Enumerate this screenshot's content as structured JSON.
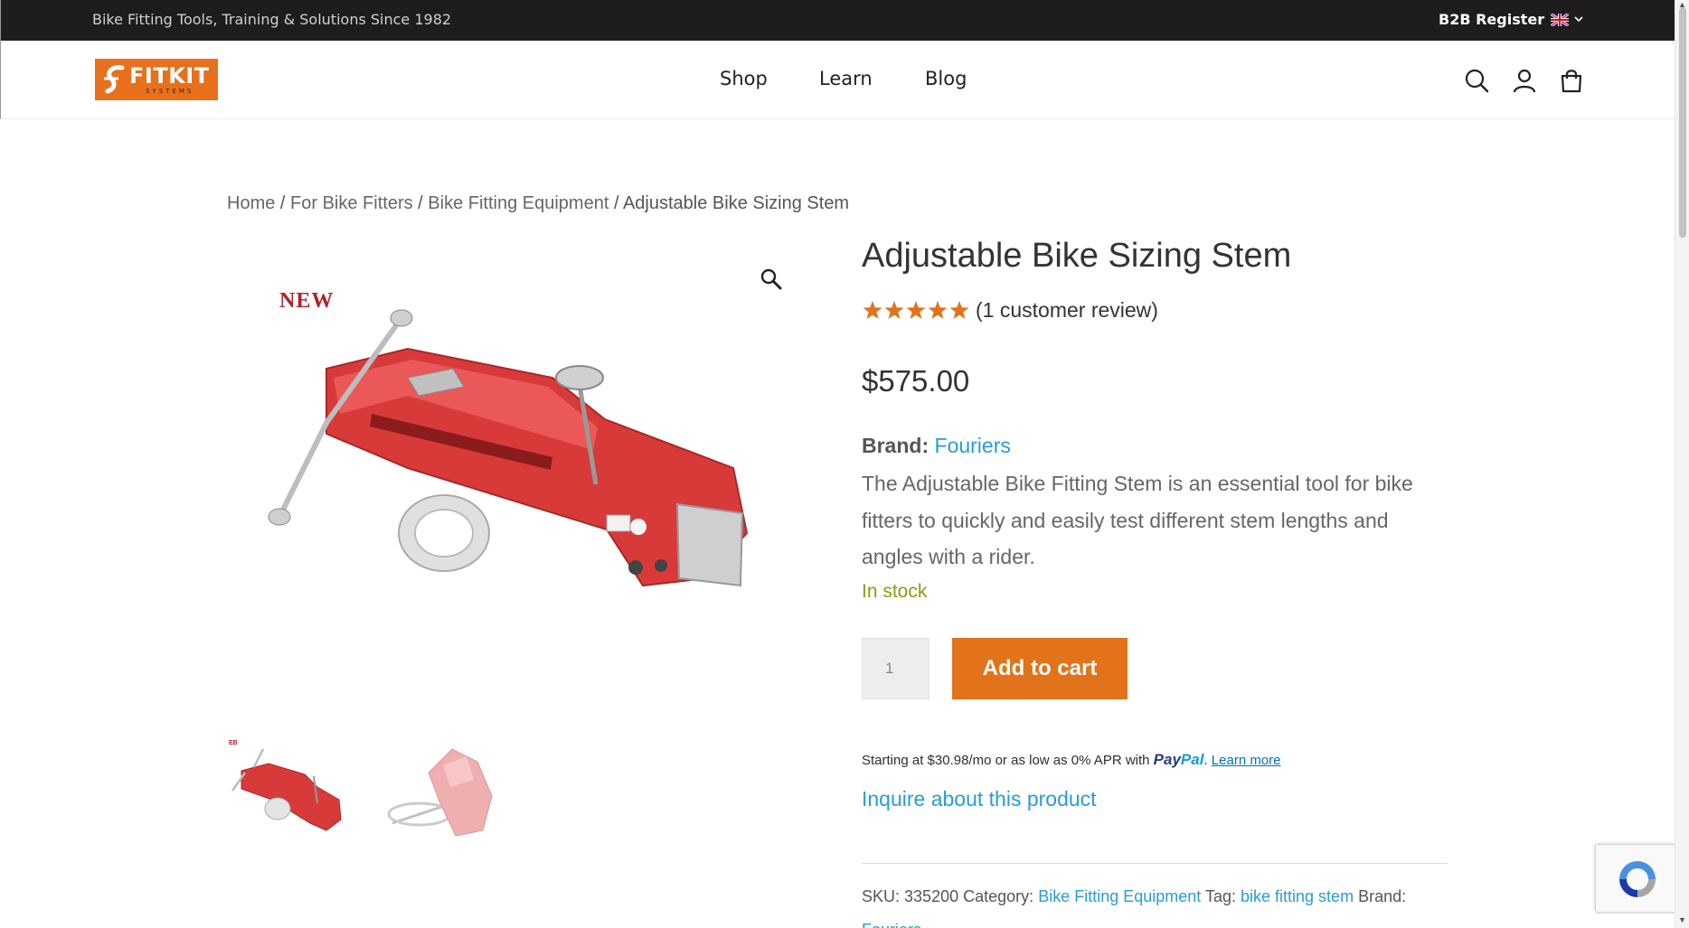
{
  "topbar": {
    "tagline": "Bike Fitting Tools, Training & Solutions Since 1982",
    "b2b_register": "B2B Register",
    "language_icon": "uk-flag-icon"
  },
  "header": {
    "logo_text": "FITKIT",
    "logo_subtext": "SYSTEMS",
    "nav": [
      "Shop",
      "Learn",
      "Blog"
    ],
    "icons": [
      "search-icon",
      "account-icon",
      "cart-icon"
    ]
  },
  "breadcrumb": {
    "items": [
      "Home",
      "For Bike Fitters",
      "Bike Fitting Equipment"
    ],
    "separator": " / ",
    "current": "Adjustable Bike Sizing Stem"
  },
  "gallery": {
    "badge": "NEW",
    "thumbnails": 2
  },
  "product": {
    "title": "Adjustable Bike Sizing Stem",
    "rating": 5,
    "rating_max": 5,
    "review_text": "(1 customer review)",
    "price": "$575.00",
    "brand_label": "Brand:",
    "brand": "Fouriers",
    "description": "The Adjustable Bike Fitting Stem is an essential tool for bike fitters to quickly and easily test different stem lengths and angles with a rider.",
    "stock": "In stock",
    "quantity": "1",
    "add_to_cart": "Add to cart",
    "paypal_text": "Starting at $30.98/mo or as low as 0% APR with",
    "paypal_brand_1": "Pay",
    "paypal_brand_2": "Pal",
    "paypal_learn_more": "Learn more",
    "inquire": "Inquire about this product"
  },
  "meta": {
    "sku_label": "SKU:",
    "sku": "335200",
    "category_label": "Category:",
    "category": "Bike Fitting Equipment",
    "tag_label": "Tag:",
    "tag": "bike fitting stem",
    "brand_label": "Brand:",
    "brand": "Fouriers"
  },
  "colors": {
    "accent": "#e2731b",
    "link": "#2a9bd6",
    "stock": "#8e9a15",
    "topbar": "#1d1d1d",
    "product_red": "#d83a3a"
  }
}
